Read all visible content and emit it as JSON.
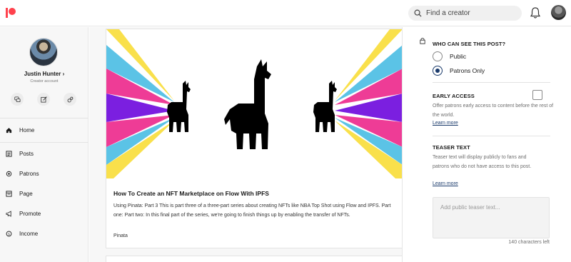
{
  "search": {
    "placeholder": "Find a creator"
  },
  "profile": {
    "name": "Justin Hunter",
    "chevron": "›",
    "subtitle": "Creator account"
  },
  "quick_actions": [
    "chat-icon",
    "edit-icon",
    "settings-icon"
  ],
  "nav": [
    {
      "label": "Home",
      "icon": "home-icon"
    },
    {
      "label": "Posts",
      "icon": "posts-icon"
    },
    {
      "label": "Patrons",
      "icon": "patrons-icon"
    },
    {
      "label": "Page",
      "icon": "page-icon"
    },
    {
      "label": "Promote",
      "icon": "promote-icon"
    },
    {
      "label": "Income",
      "icon": "income-icon"
    }
  ],
  "post": {
    "title": "How To Create an NFT Marketplace on Flow With IPFS",
    "body": "Using Pinata: Part 3 This is part three of a three-part series about creating NFTs like NBA Top Shot using Flow and IPFS. Part one: Part two: In this final part of the series, we're going to finish things up by enabling the transfer of NFTs.",
    "author": "Pinata"
  },
  "visibility": {
    "title": "WHO CAN SEE THIS POST?",
    "options": [
      {
        "label": "Public",
        "selected": false
      },
      {
        "label": "Patrons Only",
        "selected": true
      }
    ]
  },
  "early_access": {
    "title": "EARLY ACCESS",
    "checked": false,
    "description": "Offer patrons early access to content before the rest of the world.",
    "learn_more": "Learn more"
  },
  "teaser": {
    "title": "TEASER TEXT",
    "description": "Teaser text will display publicly to fans and patrons who do not have access to this post.",
    "learn_more": "Learn more",
    "placeholder": "Add public teaser text...",
    "counter": "140 characters left"
  },
  "colors": {
    "brand": "#ff424d",
    "accent": "#1a3a6b",
    "ray_yellow": "#f9e04b",
    "ray_blue": "#5bc3e6",
    "ray_pink": "#ee3c96",
    "ray_purple": "#7b1fe0"
  }
}
